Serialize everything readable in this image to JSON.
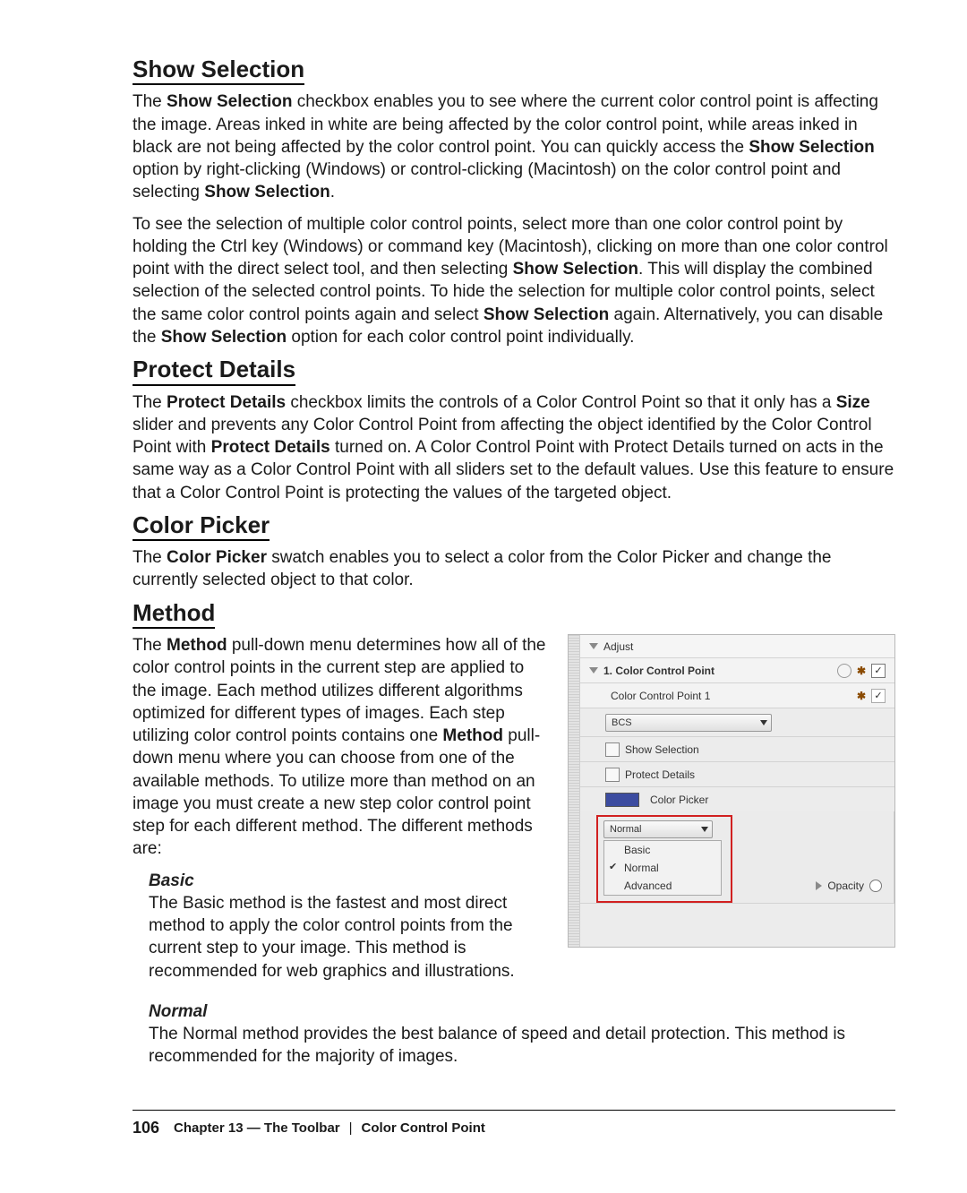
{
  "sections": {
    "show_selection": {
      "title": "Show Selection",
      "p1_a": "The ",
      "p1_b": "Show Selection",
      "p1_c": " checkbox enables you to see where the current color control point is affecting the image. Areas inked in white are being affected by the color control point, while areas inked in black are not being affected by the color control point. You can quickly access the ",
      "p1_d": "Show Selection",
      "p1_e": " option by right-clicking (Windows) or control-clicking (Macintosh) on the color control point and selecting ",
      "p1_f": "Show Selection",
      "p1_g": ".",
      "p2_a": "To see the selection of multiple color control points, select more than one color control point by holding the Ctrl key (Windows) or command key (Macintosh), clicking on more than one color control point with the direct select tool, and then selecting ",
      "p2_b": "Show Selection",
      "p2_c": ". This will display the combined selection of the selected control points. To hide the selection for multiple color control points, select the same color control points again and select ",
      "p2_d": "Show Selection",
      "p2_e": " again. Alternatively, you can disable the ",
      "p2_f": "Show Selection",
      "p2_g": " option for each color control point individually."
    },
    "protect_details": {
      "title": "Protect Details",
      "p1_a": "The ",
      "p1_b": "Protect Details",
      "p1_c": " checkbox limits the controls of a Color Control Point so that it only has a ",
      "p1_d": "Size",
      "p1_e": " slider and prevents any Color Control Point from affecting the object identified by the Color Control Point with ",
      "p1_f": "Protect Details",
      "p1_g": " turned on. A Color Control Point with Protect Details turned on acts in the same way as a Color Control Point with all sliders set to the default values. Use this feature to ensure that a Color Control Point is protecting the values of the targeted object."
    },
    "color_picker": {
      "title": "Color Picker",
      "p1_a": "The ",
      "p1_b": "Color Picker",
      "p1_c": " swatch enables you to select a color from the Color Picker and change the currently selected object to that color."
    },
    "method": {
      "title": "Method",
      "p1_a": "The ",
      "p1_b": "Method",
      "p1_c": " pull-down menu determines how all of the color control points in the current step are applied to the image. Each method utilizes different algorithms optimized for different types of images. Each step utilizing color control points contains one ",
      "p1_d": "Method",
      "p1_e": " pull-down menu where you can choose from one of the available methods. To utilize more than method on an image you must create a new step color control point step for each different method. The different methods are:",
      "sub_basic_title": "Basic",
      "sub_basic_body": "The Basic method is the fastest and most direct method to apply the color control points from the current step to your image. This method is recommended for web graphics and illustrations.",
      "sub_normal_title": "Normal",
      "sub_normal_body": "The Normal method provides the best balance of speed and detail protection. This method is recommended for the majority of images."
    }
  },
  "panel": {
    "adjust": "Adjust",
    "ccp_header": "1. Color Control Point",
    "ccp_item": "Color Control Point 1",
    "mode_select": "BCS",
    "cb_show": "Show Selection",
    "cb_protect": "Protect Details",
    "picker_label": "Color Picker",
    "method_select": "Normal",
    "dropdown": {
      "basic": "Basic",
      "normal": "Normal",
      "advanced": "Advanced"
    },
    "opacity": "Opacity"
  },
  "footer": {
    "page": "106",
    "chapter": "Chapter 13 — The Toolbar",
    "sep": "|",
    "topic": "Color Control Point"
  }
}
